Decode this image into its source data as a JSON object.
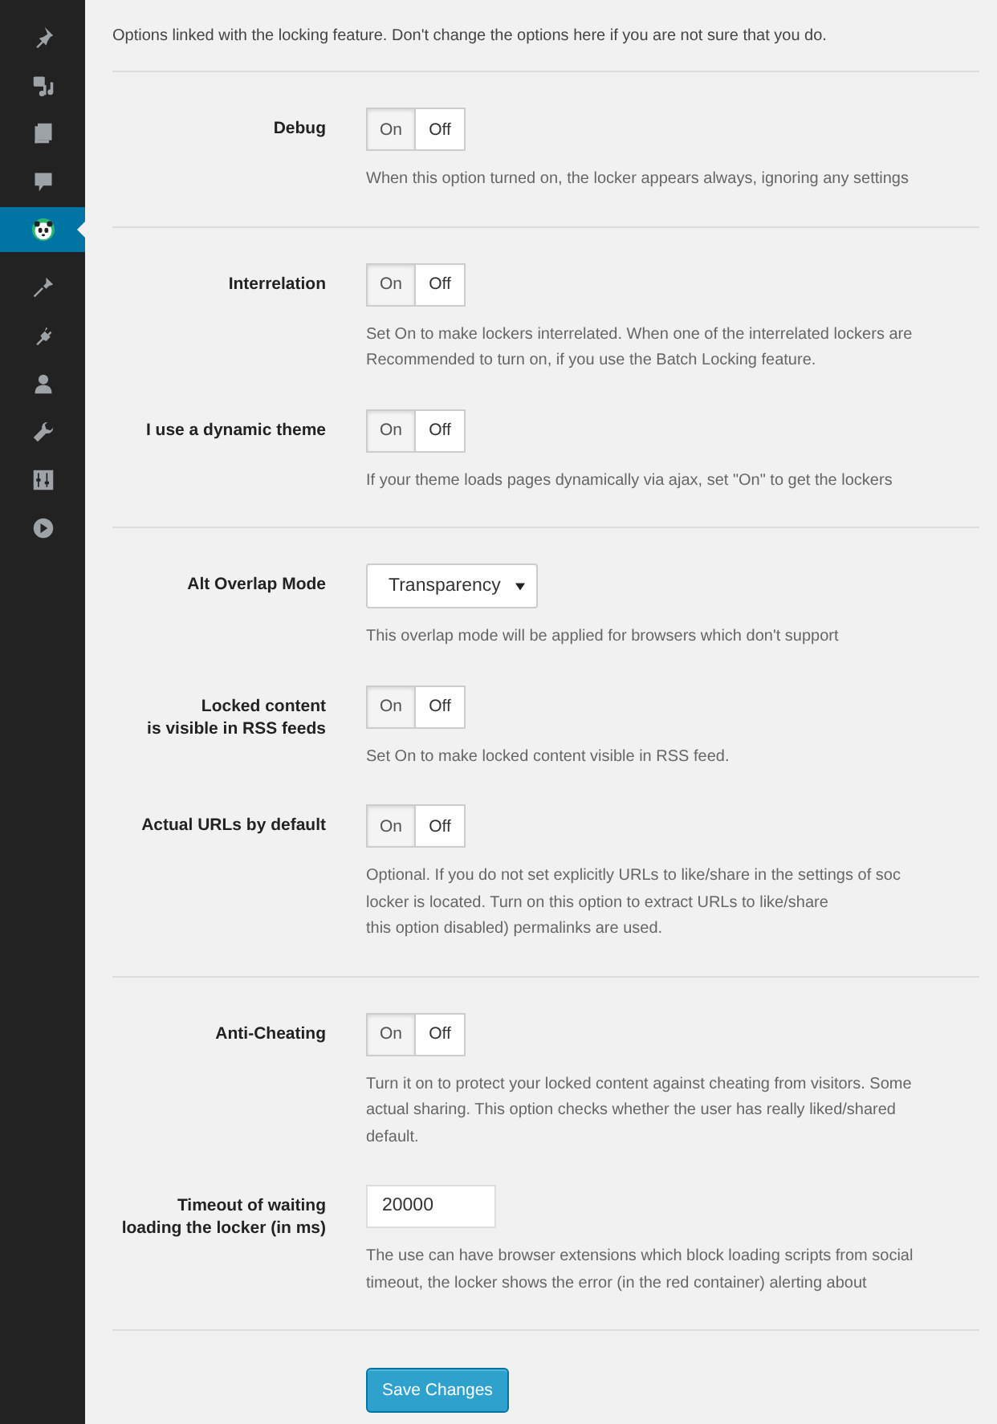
{
  "sidebar": {
    "items": [
      {
        "selected": false
      },
      {
        "selected": false
      },
      {
        "selected": false
      },
      {
        "selected": false
      },
      {
        "selected": true
      },
      {
        "selected": false
      },
      {
        "selected": false
      },
      {
        "selected": false
      },
      {
        "selected": false
      },
      {
        "selected": false
      },
      {
        "selected": false
      }
    ]
  },
  "intro": "Options linked with the locking feature. Don't change the options here if you are not sure that you do.",
  "groups": [
    {
      "rows": [
        {
          "kind": "toggle",
          "label": "Debug",
          "options": [
            {
              "label": "On",
              "selected": true
            },
            {
              "label": "Off",
              "selected": false
            }
          ],
          "description": [
            "When this option turned on, the locker appears always, ignoring any settings"
          ]
        }
      ]
    },
    {
      "rows": [
        {
          "kind": "toggle",
          "label": "Interrelation",
          "options": [
            {
              "label": "On",
              "selected": true
            },
            {
              "label": "Off",
              "selected": false
            }
          ],
          "description": [
            "Set On to make lockers interrelated. When one of the interrelated lockers are",
            "Recommended to turn on, if you use the Batch Locking feature."
          ]
        },
        {
          "kind": "toggle",
          "label": "I use a dynamic theme",
          "options": [
            {
              "label": "On",
              "selected": true
            },
            {
              "label": "Off",
              "selected": false
            }
          ],
          "description": [
            "If your theme loads pages dynamically via ajax, set \"On\" to get the lockers"
          ]
        }
      ]
    },
    {
      "rows": [
        {
          "kind": "select",
          "label": "Alt Overlap Mode",
          "value": "Transparency",
          "description": [
            "This overlap mode will be applied for browsers which don't support"
          ]
        },
        {
          "kind": "toggle",
          "label": "Locked content\nis visible in RSS feeds",
          "options": [
            {
              "label": "On",
              "selected": true
            },
            {
              "label": "Off",
              "selected": false
            }
          ],
          "description": [
            "Set On to make locked content visible in RSS feed."
          ]
        },
        {
          "kind": "toggle",
          "label": "Actual URLs by default",
          "options": [
            {
              "label": "On",
              "selected": true
            },
            {
              "label": "Off",
              "selected": false
            }
          ],
          "description": [
            "Optional. If you do not set explicitly URLs to like/share in the settings of soc",
            "locker is located. Turn on this option to extract URLs to like/share",
            "this option disabled) permalinks are used."
          ]
        }
      ]
    },
    {
      "rows": [
        {
          "kind": "toggle",
          "label": "Anti-Cheating",
          "options": [
            {
              "label": "On",
              "selected": true
            },
            {
              "label": "Off",
              "selected": false
            }
          ],
          "description": [
            "Turn it on to protect your locked content against cheating from visitors. Some",
            "actual sharing. This option checks whether the user has really liked/shared",
            "default."
          ]
        },
        {
          "kind": "input",
          "label": "Timeout of waiting\nloading the locker (in ms)",
          "value": "20000",
          "description": [
            "The use can have browser extensions which block loading scripts from social",
            "timeout, the locker shows the error (in the red container) alerting about"
          ]
        }
      ]
    }
  ],
  "save_button": "Save Changes"
}
